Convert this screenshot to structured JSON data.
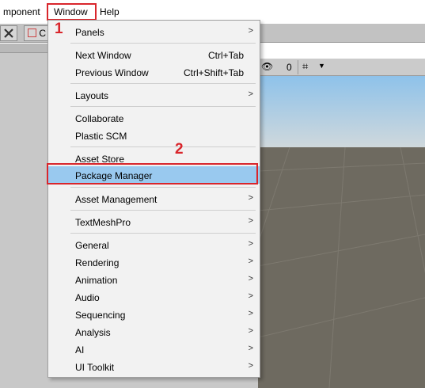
{
  "menubar": {
    "items": [
      {
        "label": "mponent"
      },
      {
        "label": "Window"
      },
      {
        "label": "Help"
      }
    ]
  },
  "annotations": {
    "step1": "1",
    "step2": "2"
  },
  "toolbar": {
    "button_text": "C",
    "visibility_count": "0"
  },
  "window_menu": {
    "items": [
      {
        "label": "Panels",
        "shortcut": "",
        "submenu": true
      },
      {
        "label": "Next Window",
        "shortcut": "Ctrl+Tab",
        "submenu": false
      },
      {
        "label": "Previous Window",
        "shortcut": "Ctrl+Shift+Tab",
        "submenu": false
      },
      {
        "label": "Layouts",
        "shortcut": "",
        "submenu": true
      },
      {
        "label": "Collaborate",
        "shortcut": "",
        "submenu": false
      },
      {
        "label": "Plastic SCM",
        "shortcut": "",
        "submenu": false
      },
      {
        "label": "Asset Store",
        "shortcut": "",
        "submenu": false
      },
      {
        "label": "Package Manager",
        "shortcut": "",
        "submenu": false,
        "highlighted": true
      },
      {
        "label": "Asset Management",
        "shortcut": "",
        "submenu": true
      },
      {
        "label": "TextMeshPro",
        "shortcut": "",
        "submenu": true
      },
      {
        "label": "General",
        "shortcut": "",
        "submenu": true
      },
      {
        "label": "Rendering",
        "shortcut": "",
        "submenu": true
      },
      {
        "label": "Animation",
        "shortcut": "",
        "submenu": true
      },
      {
        "label": "Audio",
        "shortcut": "",
        "submenu": true
      },
      {
        "label": "Sequencing",
        "shortcut": "",
        "submenu": true
      },
      {
        "label": "Analysis",
        "shortcut": "",
        "submenu": true
      },
      {
        "label": "AI",
        "shortcut": "",
        "submenu": true
      },
      {
        "label": "UI Toolkit",
        "shortcut": "",
        "submenu": true
      }
    ]
  },
  "colors": {
    "annotation": "#d9262c",
    "highlight": "#99c9ef",
    "sky": "#a9cde8",
    "ground": "#6e6a60"
  }
}
